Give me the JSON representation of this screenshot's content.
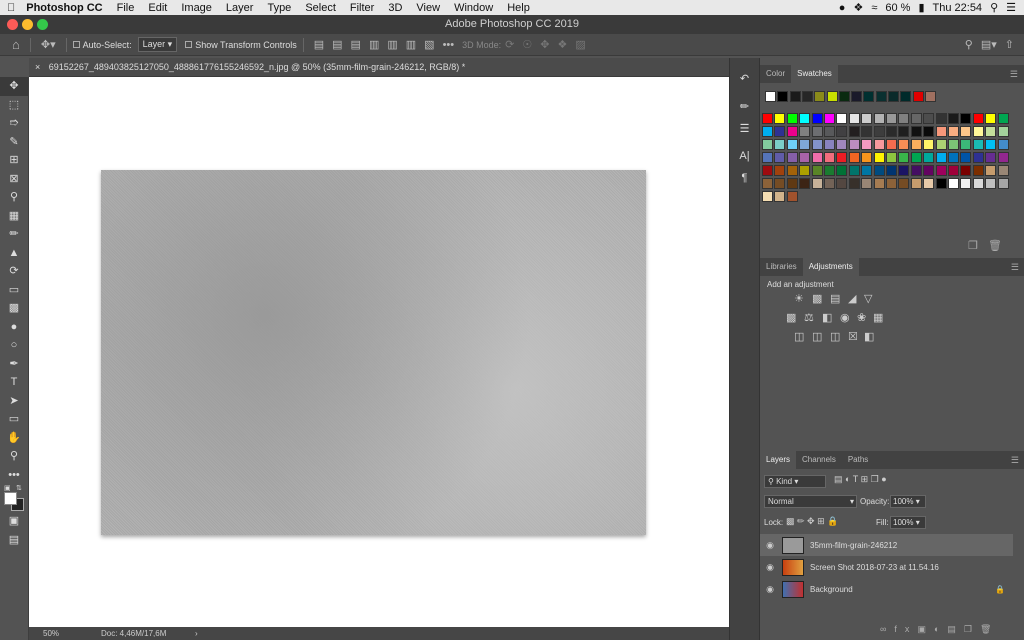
{
  "menubar": {
    "app": "Photoshop CC",
    "items": [
      "File",
      "Edit",
      "Image",
      "Layer",
      "Type",
      "Select",
      "Filter",
      "3D",
      "View",
      "Window",
      "Help"
    ],
    "battery": "60 %",
    "time": "Thu 22:54"
  },
  "titlebar": {
    "title": "Adobe Photoshop CC 2019"
  },
  "options": {
    "auto_select": "Auto-Select:",
    "layer_dropdown": "Layer",
    "show_transform": "Show Transform Controls",
    "mode_3d": "3D Mode:"
  },
  "document": {
    "tab": "69152267_489403825127050_488861776155246592_n.jpg @ 50% (35mm-film-grain-246212, RGB/8) *",
    "zoom": "50%",
    "doc_size": "Doc: 4,46M/17,6M"
  },
  "panels": {
    "color_tab": "Color",
    "swatches_tab": "Swatches",
    "libraries_tab": "Libraries",
    "adjustments_tab": "Adjustments",
    "add_adjustment": "Add an adjustment",
    "layers_tab": "Layers",
    "channels_tab": "Channels",
    "paths_tab": "Paths",
    "kind": "Kind",
    "blend_mode": "Normal",
    "opacity_label": "Opacity:",
    "opacity_value": "100%",
    "lock_label": "Lock:",
    "fill_label": "Fill:",
    "fill_value": "100%"
  },
  "layers": [
    {
      "name": "35mm-film-grain-246212",
      "selected": true
    },
    {
      "name": "Screen Shot 2018-07-23 at 11.54.16",
      "selected": false
    },
    {
      "name": "Background",
      "selected": false,
      "locked": true
    }
  ],
  "swatch_colors_row1": [
    "#ffffff",
    "#000000",
    "#1a1a1a",
    "#262626",
    "#8a8a1a",
    "#c8e000",
    "#0a2a10",
    "#1a1a2a",
    "#003030",
    "#0a3030",
    "#0a2a2a",
    "#002a2a",
    "#e00000",
    "#a07060"
  ],
  "swatch_grid": [
    [
      "#ff0000",
      "#ffff00",
      "#00ff00",
      "#00ffff",
      "#0000ff",
      "#ff00ff",
      "#ffffff",
      "#e6e6e6",
      "#cccccc",
      "#b3b3b3",
      "#999999",
      "#808080",
      "#666666",
      "#4d4d4d",
      "#333333",
      "#1a1a1a",
      "#000000",
      "#ff0000",
      "#ffff00",
      "#00a651"
    ],
    [
      "#00aeef",
      "#2e3192",
      "#ec008c",
      "#808080",
      "#6d6e71",
      "#58595b",
      "#414042",
      "#231f20",
      "#333333",
      "#3d3d3d",
      "#2b2b2b",
      "#1f1f1f",
      "#111111",
      "#0a0a0a",
      "#f7977a",
      "#f9ad81",
      "#fdc68a",
      "#fff799",
      "#c4df9b",
      "#a3d39c"
    ],
    [
      "#82ca9d",
      "#7bcdc8",
      "#6ecff6",
      "#7ea7d8",
      "#8393ca",
      "#8882be",
      "#a187be",
      "#bc8dbf",
      "#f49ac2",
      "#f6989d",
      "#f26c4f",
      "#f68e55",
      "#fbaf5d",
      "#fff568",
      "#acd372",
      "#7cc576",
      "#3bb878",
      "#1abbb4",
      "#00bff3",
      "#438ccb"
    ],
    [
      "#5574b9",
      "#605ca8",
      "#855fa8",
      "#a763a8",
      "#f06eaa",
      "#f26d7d",
      "#ed1c24",
      "#f26522",
      "#f7941d",
      "#fff200",
      "#8dc63f",
      "#39b54a",
      "#00a651",
      "#00a99d",
      "#00aeef",
      "#0072bc",
      "#0054a6",
      "#2e3192",
      "#662d91",
      "#92278f"
    ],
    [
      "#9e0b0f",
      "#a0410d",
      "#a36209",
      "#aba000",
      "#598527",
      "#1a7b30",
      "#007236",
      "#00746b",
      "#0076a3",
      "#004b80",
      "#003471",
      "#1b1464",
      "#440e62",
      "#630460",
      "#9e005d",
      "#9e0039",
      "#790000",
      "#7b2e00",
      "#c69c6d",
      "#998675"
    ],
    [
      "#8c6239",
      "#754c24",
      "#603913",
      "#3c2415",
      "#c7b299",
      "#736357",
      "#534741",
      "#37302a",
      "#998675",
      "#a67c52",
      "#8c6239",
      "#754c24",
      "#c69c6d",
      "#e6c9a8",
      "#000000",
      "#ffffff",
      "#f2f2f2",
      "#d9d9d9",
      "#bfbfbf",
      "#a6a6a6"
    ],
    [
      "#f5deb3",
      "#d2b48c",
      "#a0522d"
    ]
  ]
}
